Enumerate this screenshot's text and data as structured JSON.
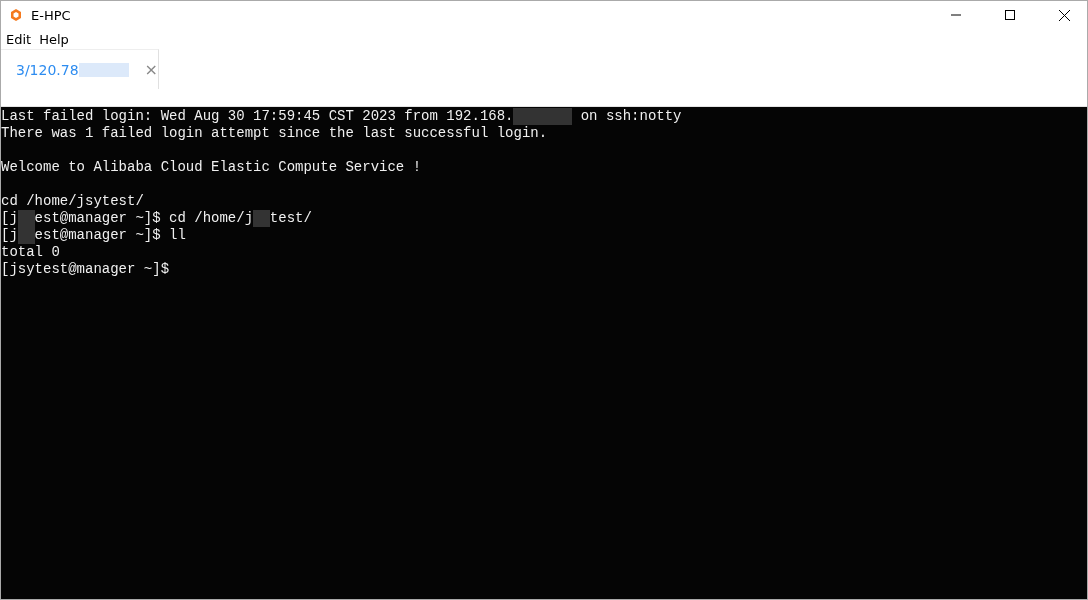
{
  "window": {
    "title": "E-HPC"
  },
  "menu": [
    "Edit",
    "Help"
  ],
  "tabs": [
    {
      "label": "3/120.78",
      "selected": true,
      "redacted": true,
      "close": "×"
    }
  ],
  "terminal": {
    "lines": [
      [
        {
          "kind": "text",
          "text": "Last failed login: Wed Aug 30 17:59:45 CST 2023 from 192.168."
        },
        {
          "kind": "redacted_long"
        },
        {
          "kind": "text",
          "text": " on ssh:notty"
        }
      ],
      [
        {
          "kind": "text",
          "text": "There was 1 failed login attempt since the last successful login."
        }
      ],
      [
        {
          "kind": "blank"
        }
      ],
      [
        {
          "kind": "text",
          "text": "Welcome to Alibaba Cloud Elastic Compute Service !"
        }
      ],
      [
        {
          "kind": "blank"
        }
      ],
      [
        {
          "kind": "text",
          "text": "cd /home/jsytest/"
        }
      ],
      [
        {
          "kind": "text",
          "text": "[j"
        },
        {
          "kind": "redacted_short"
        },
        {
          "kind": "text",
          "text": "est@manager ~]$ cd /home/j"
        },
        {
          "kind": "redacted_short"
        },
        {
          "kind": "text",
          "text": "test/"
        }
      ],
      [
        {
          "kind": "text",
          "text": "[j"
        },
        {
          "kind": "redacted_short"
        },
        {
          "kind": "text",
          "text": "est@manager ~]$ ll"
        }
      ],
      [
        {
          "kind": "text",
          "text": "total 0"
        }
      ],
      [
        {
          "kind": "text",
          "text": "[jsytest@manager ~]$"
        }
      ]
    ]
  }
}
